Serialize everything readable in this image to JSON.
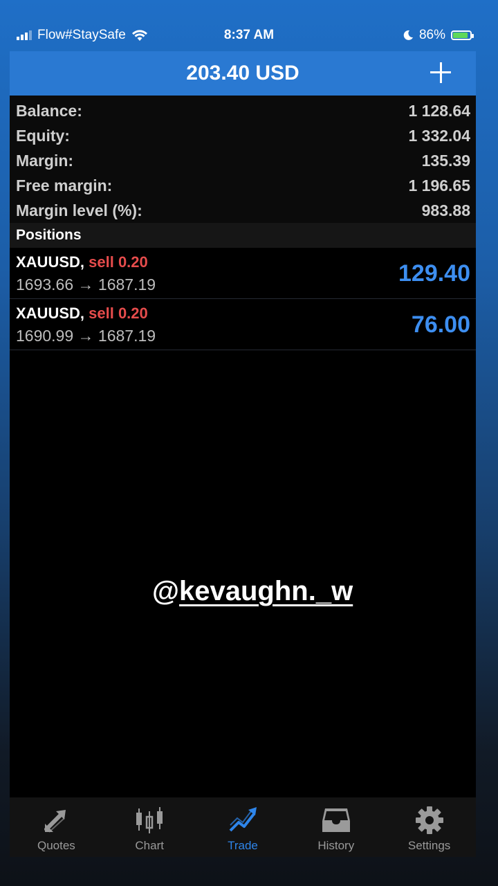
{
  "status_bar": {
    "carrier": "Flow#StaySafe",
    "time": "8:37 AM",
    "battery_pct": "86%",
    "battery_level": 0.86
  },
  "header": {
    "title": "203.40 USD",
    "add_icon": "plus-icon"
  },
  "account": {
    "balance": {
      "label": "Balance:",
      "value": "1 128.64"
    },
    "equity": {
      "label": "Equity:",
      "value": "1 332.04"
    },
    "margin": {
      "label": "Margin:",
      "value": "135.39"
    },
    "free_margin": {
      "label": "Free margin:",
      "value": "1 196.65"
    },
    "margin_level": {
      "label": "Margin level (%):",
      "value": "983.88"
    }
  },
  "positions": {
    "title": "Positions",
    "items": [
      {
        "symbol": "XAUUSD,",
        "side": "sell 0.20",
        "prices": "1693.66 → 1687.19",
        "profit": "129.40"
      },
      {
        "symbol": "XAUUSD,",
        "side": "sell 0.20",
        "prices": "1690.99 → 1687.19",
        "profit": "76.00"
      }
    ]
  },
  "watermark": {
    "at": "@",
    "user": "kevaughn._w"
  },
  "tabs": [
    {
      "label": "Quotes",
      "icon": "quotes-arrows-icon"
    },
    {
      "label": "Chart",
      "icon": "candlestick-icon"
    },
    {
      "label": "Trade",
      "icon": "trend-arrow-icon",
      "active": true
    },
    {
      "label": "History",
      "icon": "inbox-tray-icon"
    },
    {
      "label": "Settings",
      "icon": "gear-icon"
    }
  ],
  "colors": {
    "accent": "#2e85ea",
    "header": "#2a79d2",
    "sell": "#e64c4c",
    "profit": "#3d8ef0"
  }
}
